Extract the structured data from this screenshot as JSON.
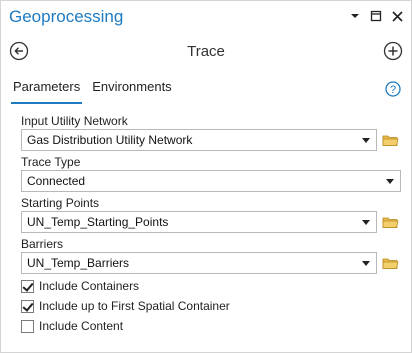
{
  "window": {
    "title": "Geoprocessing"
  },
  "tool": {
    "title": "Trace"
  },
  "tabs": [
    {
      "label": "Parameters",
      "active": true
    },
    {
      "label": "Environments",
      "active": false
    }
  ],
  "params": {
    "input_network": {
      "label": "Input Utility Network",
      "value": "Gas Distribution Utility Network"
    },
    "trace_type": {
      "label": "Trace Type",
      "value": "Connected"
    },
    "starting_points": {
      "label": "Starting Points",
      "value": "UN_Temp_Starting_Points"
    },
    "barriers": {
      "label": "Barriers",
      "value": "UN_Temp_Barriers"
    }
  },
  "checkboxes": [
    {
      "label": "Include Containers",
      "checked": true
    },
    {
      "label": "Include up to First Spatial Container",
      "checked": true
    },
    {
      "label": "Include Content",
      "checked": false
    }
  ],
  "colors": {
    "accent": "#1e7bc2",
    "folder": "#e8b84a"
  },
  "icons": [
    "chevron-down-icon",
    "pin-icon",
    "close-icon",
    "back-icon",
    "add-icon",
    "help-icon",
    "folder-icon"
  ]
}
